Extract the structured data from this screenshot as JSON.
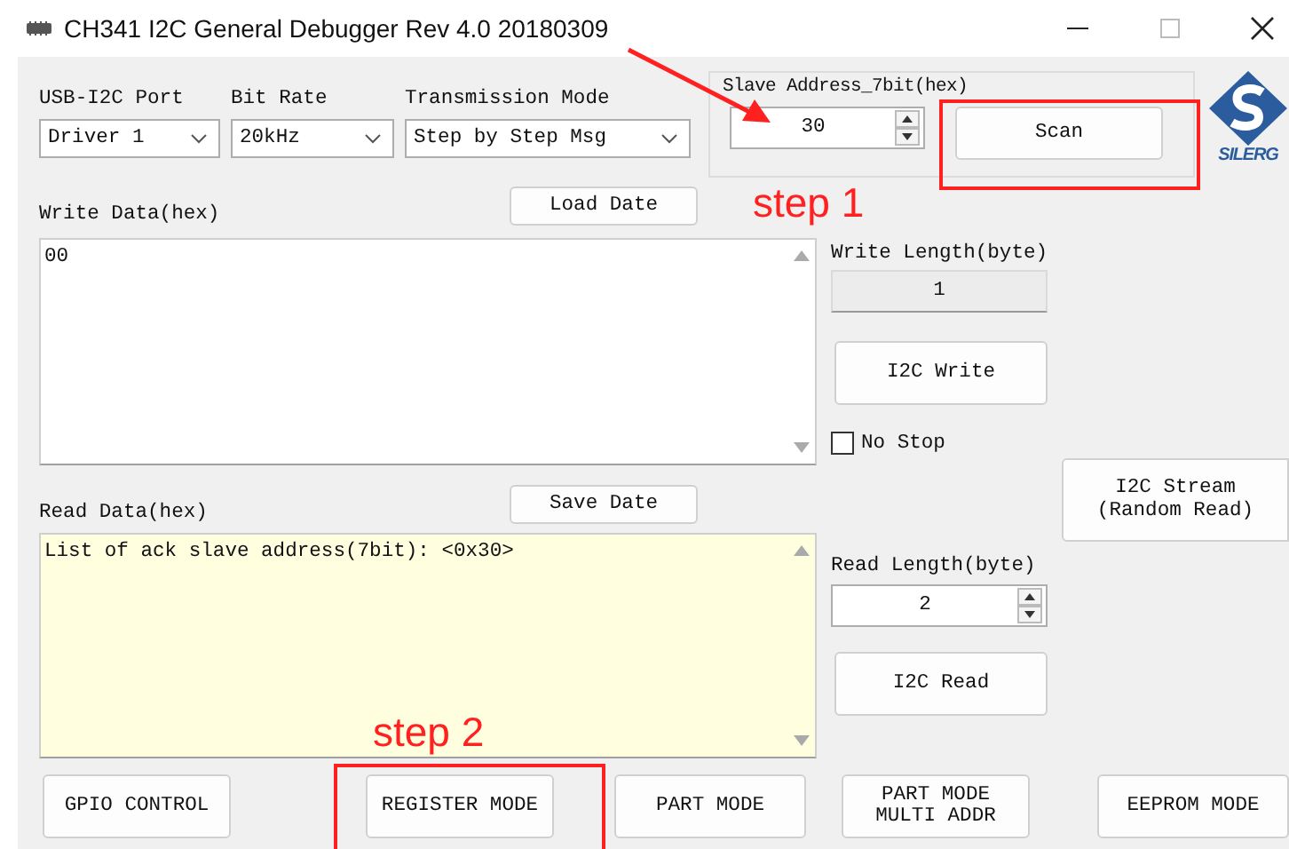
{
  "window": {
    "title": "CH341 I2C General Debugger Rev 4.0 20180309"
  },
  "port": {
    "label": "USB-I2C Port",
    "value": "Driver 1"
  },
  "bit_rate": {
    "label": "Bit Rate",
    "value": "20kHz"
  },
  "transmission_mode": {
    "label": "Transmission Mode",
    "value": "Step by Step Msg"
  },
  "slave_address": {
    "label": "Slave Address_7bit(hex)",
    "value": "30",
    "button": "Scan"
  },
  "logo": {
    "text": "SILERG"
  },
  "write_data": {
    "label": "Write Data(hex)",
    "button": "Load Date",
    "value": "00"
  },
  "write_length": {
    "label": "Write Length(byte)",
    "value": "1"
  },
  "write_button": "I2C Write",
  "no_stop": {
    "label": "No Stop",
    "checked": false
  },
  "stream_button": {
    "lines": [
      "I2C Stream",
      "(Random Read)"
    ]
  },
  "read_data": {
    "label": "Read Data(hex)",
    "button": "Save Date",
    "value": "List of ack slave address(7bit): <0x30>"
  },
  "read_length": {
    "label": "Read Length(byte)",
    "value": "2"
  },
  "read_button": "I2C Read",
  "mode_buttons": [
    {
      "lines": [
        "GPIO CONTROL"
      ]
    },
    {
      "lines": [
        "REGISTER MODE"
      ]
    },
    {
      "lines": [
        "PART MODE"
      ]
    },
    {
      "lines": [
        "PART MODE",
        "MULTI ADDR"
      ]
    },
    {
      "lines": [
        "EEPROM MODE"
      ]
    }
  ],
  "annotations": [
    {
      "text": "step 1"
    },
    {
      "text": "step 2"
    }
  ]
}
